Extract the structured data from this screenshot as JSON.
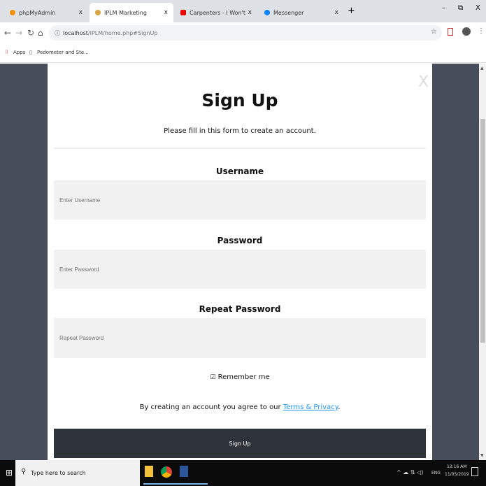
{
  "tabs": [
    {
      "title": "phpMyAdmin",
      "active": false
    },
    {
      "title": "IPLM Marketing",
      "active": true
    },
    {
      "title": "Carpenters - I Won't Last A D",
      "active": false
    },
    {
      "title": "Messenger",
      "active": false
    }
  ],
  "window_controls": {
    "minimize": "–",
    "restore": "⧉",
    "close": "X"
  },
  "address": {
    "host": "localhost",
    "path": "/IPLM/home.php#SignUp"
  },
  "bookmarks": {
    "apps": "Apps",
    "item1": "Pedometer and Ste..."
  },
  "modal": {
    "close": "X",
    "title": "Sign Up",
    "subtitle": "Please fill in this form to create an account.",
    "username_label": "Username",
    "username_placeholder": "Enter Username",
    "password_label": "Password",
    "password_placeholder": "Enter Password",
    "repeat_label": "Repeat Password",
    "repeat_placeholder": "Repeat Password",
    "remember": "Remember me",
    "remember_checked": true,
    "terms_prefix": "By creating an account you agree to our ",
    "terms_link": "Terms & Privacy",
    "terms_suffix": ".",
    "submit": "Sign Up"
  },
  "taskbar": {
    "search": "Type here to search",
    "lang": "ENG",
    "time": "12:16 AM",
    "date": "11/05/2019"
  },
  "colors": {
    "accent_link": "#2196f3",
    "button": "#2f343b",
    "backdrop": "#484d5b"
  }
}
